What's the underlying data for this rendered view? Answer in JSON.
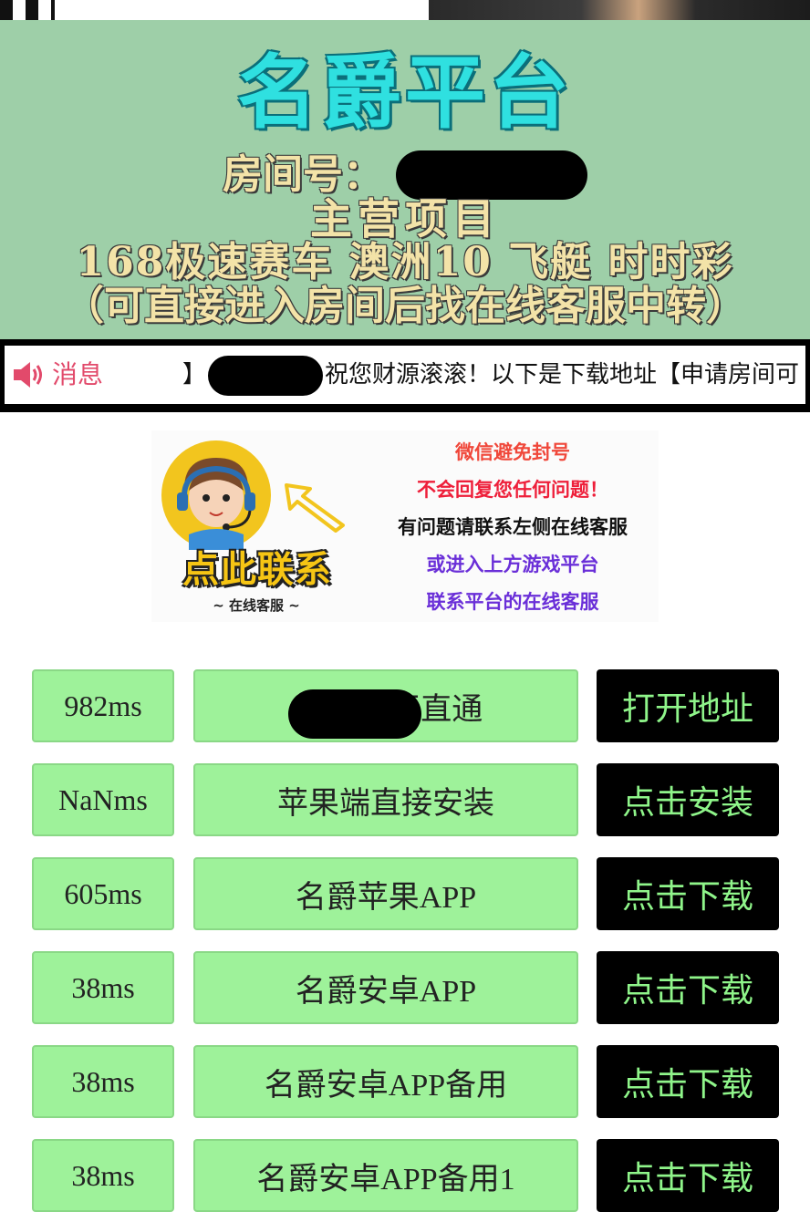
{
  "banner": {
    "title": "名爵平台",
    "room_label": "房间号：",
    "main_label": "主营项目",
    "games": "168极速赛车  澳洲10 飞艇 时时彩",
    "note": "（可直接进入房间后找在线客服中转）",
    "colors": {
      "background": "#9ecfa8",
      "title": "#2fe0e0",
      "text": "#f3e3a8"
    }
  },
  "notice": {
    "icon": "speaker-icon",
    "label": "消息",
    "ticker_prefix": "】",
    "ticker_text": "祝您财源滚滚！以下是下载地址【申请房间可"
  },
  "ad": {
    "contact_title": "点此联系",
    "contact_sub": "~ 在线客服 ~",
    "lines": [
      {
        "text": "微信避免封号",
        "color": "#f0473a"
      },
      {
        "text": "不会回复您任何问题！",
        "color": "#ee1f3a"
      },
      {
        "text": "有问题请联系左侧在线客服",
        "color": "#111111"
      },
      {
        "text": "或进入上方游戏平台",
        "color": "#6a2fd8"
      },
      {
        "text": "联系平台的在线客服",
        "color": "#6a2fd8"
      }
    ]
  },
  "rows": [
    {
      "ms": "982ms",
      "name": "名爵     试玩直通",
      "button": "打开地址"
    },
    {
      "ms": "NaNms",
      "name": "苹果端直接安装",
      "button": "点击安装"
    },
    {
      "ms": "605ms",
      "name": "名爵苹果APP",
      "button": "点击下载"
    },
    {
      "ms": "38ms",
      "name": "名爵安卓APP",
      "button": "点击下载"
    },
    {
      "ms": "38ms",
      "name": "名爵安卓APP备用",
      "button": "点击下载"
    },
    {
      "ms": "38ms",
      "name": "名爵安卓APP备用1",
      "button": "点击下载"
    }
  ]
}
